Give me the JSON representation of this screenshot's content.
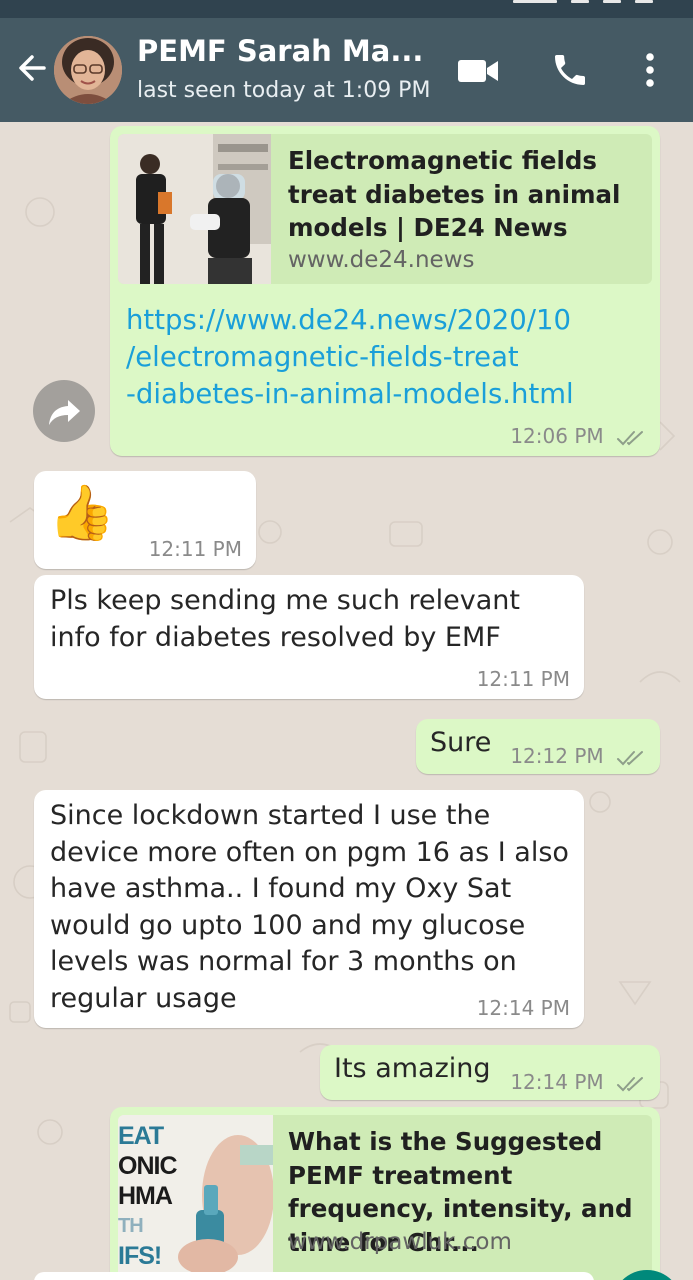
{
  "header": {
    "contact_name": "PEMF Sarah Ma...",
    "last_seen": "last seen today at 1:09 PM",
    "icons": [
      "back-arrow-icon",
      "avatar",
      "video-call-icon",
      "voice-call-icon",
      "more-options-icon"
    ]
  },
  "messages": {
    "m1": {
      "direction": "outgoing",
      "preview_title": "Electromagnetic fields treat diabetes in animal models | DE24 News",
      "preview_domain": "www.de24.news",
      "link": "https://www.de24.news/2020/10/electromagnetic-fields-treat-diabetes-in-animal-models.html",
      "link_lines": [
        "https://www.de24.news/2020/10",
        "/electromagnetic-fields-treat",
        "-diabetes-in-animal-models.html"
      ],
      "time": "12:06 PM",
      "status": "read"
    },
    "m2": {
      "direction": "incoming",
      "emoji": "👍",
      "time": "12:11 PM"
    },
    "m3": {
      "direction": "incoming",
      "text": "Pls keep sending me such relevant info for diabetes resolved by EMF",
      "time": "12:11 PM"
    },
    "m4": {
      "direction": "outgoing",
      "text": "Sure",
      "time": "12:12 PM",
      "status": "read"
    },
    "m5": {
      "direction": "incoming",
      "text": "Since lockdown started I use the device more often on pgm 16 as I also have asthma.. I found my Oxy Sat would go upto 100 and my glucose levels was normal for 3 months on regular usage",
      "time": "12:14 PM"
    },
    "m6": {
      "direction": "outgoing",
      "text": "Its amazing",
      "time": "12:14 PM",
      "status": "read"
    },
    "m7": {
      "direction": "outgoing",
      "preview_title": "What is the Suggested PEMF treatment frequency, intensity, and time for Chr...",
      "preview_domain": "www.drpawluk.com",
      "thumb_text": [
        "EAT",
        "ONIC",
        "HMA",
        "TH",
        "IFS!"
      ]
    }
  },
  "colors": {
    "header": "#455a64",
    "chat_bg": "#e5ddd5",
    "outgoing": "#dcf8c6",
    "incoming": "#ffffff",
    "link": "#1a9fd9",
    "tick_read": "#8e9e8a"
  }
}
